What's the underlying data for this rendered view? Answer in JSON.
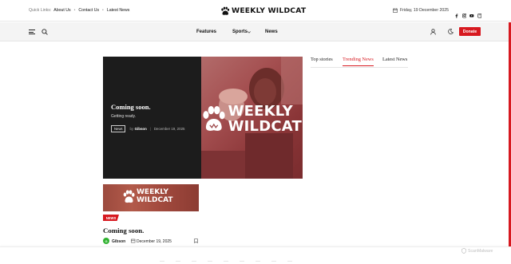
{
  "topbar": {
    "quick_links_label": "Quick Links:",
    "quick_links": [
      "About Us",
      "Contact Us",
      "Latest News"
    ],
    "site_name": "WEEKLY WILDCAT",
    "date": "Friday, 19 December 2025",
    "socials": [
      "facebook-icon",
      "instagram-icon",
      "youtube-icon",
      "mail-icon"
    ]
  },
  "nav": {
    "items": [
      "Features",
      "Sports",
      "News"
    ],
    "donate_label": "Donate"
  },
  "hero": {
    "title": "Coming soon.",
    "subtitle": "Getting ready.",
    "tag": "News",
    "by": "by",
    "author": "Gibson",
    "date": "December 19, 2025",
    "logo_line1": "WEEKLY",
    "logo_line2": "WILDCAT"
  },
  "tabs": {
    "items": [
      "Top stories",
      "Trending News",
      "Latest News"
    ],
    "active_index": 1
  },
  "card": {
    "logo_line1": "WEEKLY",
    "logo_line2": "WILDCAT",
    "badge": "NEWS",
    "title": "Coming soon.",
    "author_initial": "G",
    "author": "Gibson",
    "date": "December 19, 2025"
  },
  "footer": {
    "watermark": "ScanMalware"
  },
  "colors": {
    "accent": "#d71920",
    "hero_bg": "#1c1c1c",
    "avatar": "#2fb12f"
  }
}
